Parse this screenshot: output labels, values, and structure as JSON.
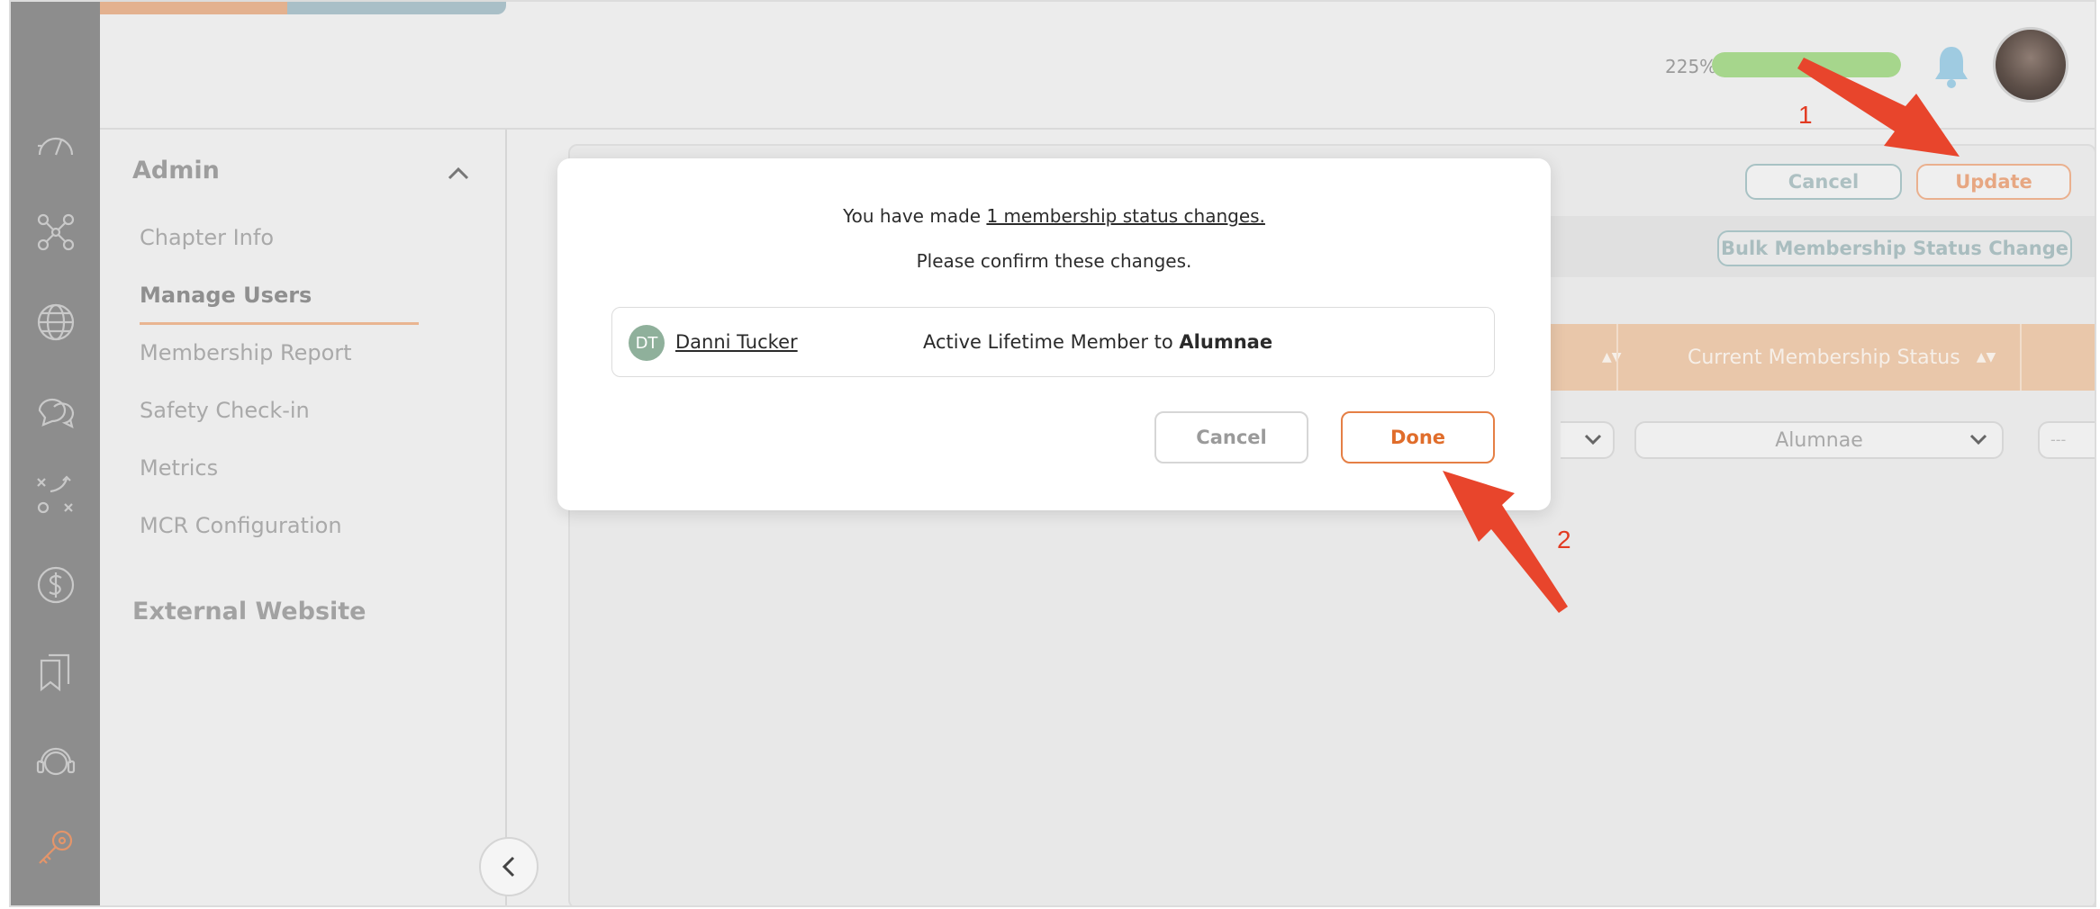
{
  "topbar": {
    "progress_text": "225%",
    "progress_fraction": 1.0,
    "bell_icon": "bell-icon",
    "avatar_icon": "user-avatar"
  },
  "rail": {
    "icons": [
      "dashboard-gauge-icon",
      "network-nodes-icon",
      "globe-icon",
      "chat-bubbles-icon",
      "strategy-icon",
      "dollar-icon",
      "bookmarks-icon",
      "support-headset-icon",
      "key-icon"
    ]
  },
  "sidebar": {
    "title": "Admin",
    "items": [
      "Chapter Info",
      "Manage Users",
      "Membership Report",
      "Safety Check-in",
      "Metrics",
      "MCR Configuration"
    ],
    "section2": "External Website"
  },
  "main": {
    "cancel_label": "Cancel",
    "update_label": "Update",
    "bulk_label": "Bulk Membership Status Change",
    "header_col": "Current Membership Status",
    "status_value": "Alumnae",
    "dash_value": "---"
  },
  "modal": {
    "line1_prefix": "You have made ",
    "line1_link": "1 membership status changes.",
    "line2": "Please confirm these changes.",
    "change": {
      "initials": "DT",
      "name": "Danni Tucker",
      "from_status": "Active Lifetime Member to ",
      "to_status": "Alumnae"
    },
    "cancel_label": "Cancel",
    "done_label": "Done"
  },
  "annotations": {
    "step1": "1",
    "step2": "2"
  },
  "colors": {
    "accent_orange": "#e57f45",
    "annotation_red": "#e23b22",
    "teal_outline": "#a8c2c4",
    "progress_green": "#a6d68c"
  }
}
